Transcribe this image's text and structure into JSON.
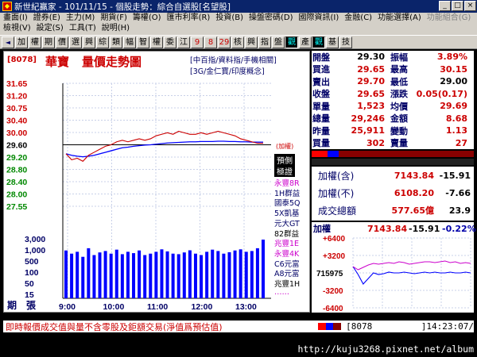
{
  "window": {
    "title": "新世紀贏家 - 101/11/15 - 個股走勢：綜合自選股[名望股]",
    "icon": "app-icon"
  },
  "menu": {
    "row1": [
      "畫面(I)",
      "證券(E)",
      "主力(M)",
      "期貨(F)",
      "籌權(O)",
      "匯市利率(R)",
      "投資(B)",
      "操盤密碼(D)",
      "國際資訊(I)",
      "金融(C)",
      "功能選擇(A)"
    ],
    "row1_disabled": "功能組合(G)",
    "row2": [
      "檢視(V)",
      "設定(S)",
      "工具(T)",
      "說明(H)"
    ]
  },
  "toolbar": {
    "buttons": [
      "◄",
      "加",
      "權",
      "期",
      "價",
      "選",
      "興",
      "綜",
      "類",
      "幅",
      "智",
      "權",
      "委",
      "江",
      "9",
      "8",
      "29",
      "核",
      "興",
      "指",
      "盤",
      "觀",
      "產",
      "觀",
      "基",
      "技"
    ],
    "pressed": [
      21,
      23
    ]
  },
  "stock": {
    "code": "[8078]",
    "name": "華寶",
    "chart_title": "量價走勢圖",
    "concepts1": "[中百指/資料指/手機相關]",
    "concepts2": "[3G/金仁寶/印度概念]",
    "plus_label": "(加權)",
    "labels_side": [
      "預側",
      "極證"
    ],
    "brokers": [
      "永豐8R",
      "1H群益",
      "國泰5Q",
      "5X凱基",
      "元大GT",
      "82群益",
      "兆豐1E",
      "永豐4K",
      "C6元富",
      "A8元富",
      "兆豐1H",
      "‥‥‥"
    ],
    "vol_axis_label": "期　張"
  },
  "quote": [
    {
      "l": "開盤",
      "v": "29.30",
      "l2": "振幅",
      "v2": "3.89%",
      "c1": "#000",
      "c2": "#c00"
    },
    {
      "l": "買進",
      "v": "29.65",
      "l2": "最高",
      "v2": "30.15",
      "c1": "#c00",
      "c2": "#c00"
    },
    {
      "l": "賣出",
      "v": "29.70",
      "l2": "最低",
      "v2": "29.00",
      "c1": "#c00",
      "c2": "#000"
    },
    {
      "l": "收盤",
      "v": "29.65",
      "l2": "漲跌",
      "v2": "0.05(0.17)",
      "c1": "#c00",
      "c2": "#c00"
    },
    {
      "l": "單量",
      "v": "1,523",
      "l2": "均價",
      "v2": "29.69",
      "c1": "#c00",
      "c2": "#c00"
    },
    {
      "l": "總量",
      "v": "29,246",
      "l2": "金額",
      "v2": "8.68",
      "c1": "#c00",
      "c2": "#c00"
    },
    {
      "l": "昨量",
      "v": "25,911",
      "l2": "變動",
      "v2": "1.13",
      "c1": "#c00",
      "c2": "#c00"
    },
    {
      "l": "買量",
      "v": "302",
      "l2": "賣量",
      "v2": "27",
      "c1": "#c00",
      "c2": "#c00"
    }
  ],
  "index": [
    {
      "l": "加權(含)",
      "v": "7143.84",
      "c": "-15.91"
    },
    {
      "l": "加權(不)",
      "v": "6108.20",
      "c": "-7.66"
    },
    {
      "l": "成交總額",
      "v": "577.65億",
      "c": "23.9"
    }
  ],
  "mini": {
    "label": "加權",
    "value": "7143.84",
    "change": "-15.91",
    "pct": "-0.22%",
    "ticks": [
      "+6400",
      "+3200",
      "715975",
      "-3200",
      "-6400"
    ]
  },
  "status": {
    "msg": "即時報價成交值與量不含零股及鉅額交易(淨值爲預估值)",
    "code": "[8078",
    "time": "]14:23:07/"
  },
  "url": "http://kuju3268.pixnet.net/album",
  "chart_data": {
    "type": "line",
    "title": "量價走勢圖",
    "x_ticks": [
      "9:00",
      "10:00",
      "11:00",
      "12:00",
      "13:00"
    ],
    "y_ticks": [
      "31.65",
      "31.20",
      "30.75",
      "30.40",
      "30.00",
      "29.60",
      "29.20",
      "28.80",
      "28.40",
      "28.00",
      "27.55"
    ],
    "reference": 29.6,
    "ylim": [
      27.55,
      31.65
    ],
    "price": [
      29.3,
      29.1,
      29.15,
      29.05,
      29.25,
      29.35,
      29.45,
      29.55,
      29.6,
      29.7,
      29.75,
      29.7,
      29.75,
      29.8,
      29.75,
      29.8,
      29.9,
      29.95,
      30.0,
      29.95,
      30.05,
      30.0,
      29.95,
      29.95,
      30.0,
      29.95,
      30.0,
      30.05,
      30.0,
      29.95,
      29.9,
      29.8,
      29.75,
      29.7,
      29.65,
      29.65
    ],
    "avg": [
      29.3,
      29.25,
      29.22,
      29.2,
      29.22,
      29.25,
      29.3,
      29.35,
      29.4,
      29.45,
      29.5,
      29.52,
      29.55,
      29.57,
      29.59,
      29.6,
      29.62,
      29.64,
      29.66,
      29.67,
      29.68,
      29.69,
      29.7,
      29.7,
      29.71,
      29.71,
      29.71,
      29.72,
      29.72,
      29.71,
      29.71,
      29.7,
      29.7,
      29.69,
      29.69,
      29.69
    ],
    "volume_ticks": [
      "3,000",
      "1,000",
      "500",
      "100",
      "50",
      "15"
    ],
    "volume": [
      450,
      300,
      380,
      200,
      600,
      250,
      350,
      420,
      300,
      500,
      280,
      380,
      320,
      450,
      250,
      300,
      380,
      520,
      400,
      300,
      280,
      350,
      460,
      300,
      250,
      380,
      500,
      420,
      300,
      360,
      450,
      520,
      380,
      420,
      600,
      1800
    ]
  }
}
